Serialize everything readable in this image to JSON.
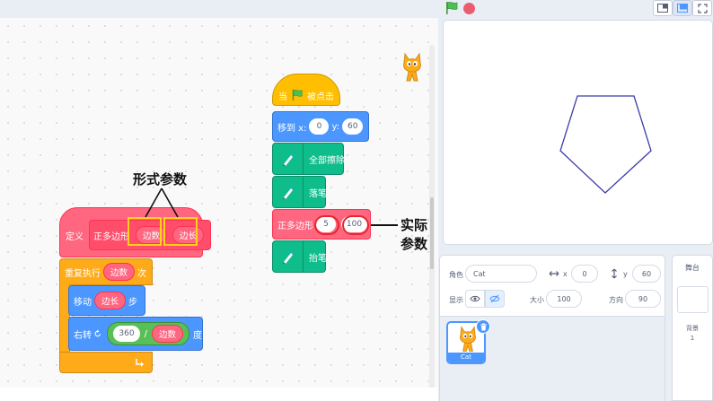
{
  "blocks": {
    "when_flag": {
      "prefix": "当",
      "suffix": "被点击"
    },
    "goto": {
      "label": "移到 x:",
      "x": "0",
      "y_label": "y:",
      "y": "60"
    },
    "clear": "全部擦除",
    "pen_down": "落笔",
    "call": {
      "name": "正多边形",
      "arg1": "5",
      "arg2": "100"
    },
    "pen_up": "抬笔",
    "define": {
      "label": "定义",
      "name": "正多边形",
      "param1": "边数",
      "param2": "边长"
    },
    "repeat": {
      "label": "重复执行",
      "count": "边数",
      "suffix": "次"
    },
    "move": {
      "label": "移动",
      "steps": "边长",
      "suffix": "步"
    },
    "turn": {
      "label": "右转",
      "dividend": "360",
      "op": "/",
      "divisor": "边数",
      "suffix": "度"
    }
  },
  "annotations": {
    "formal": "形式参数",
    "actual": "实际参数"
  },
  "sprite": {
    "name_label": "角色",
    "name": "Cat",
    "x_label": "x",
    "x": "0",
    "y_label": "y",
    "y": "60",
    "show_label": "显示",
    "size_label": "大小",
    "size": "100",
    "direction_label": "方向",
    "direction": "90",
    "thumb_label": "Cat"
  },
  "stage_selector": {
    "title": "舞台",
    "backdrop_label": "背景",
    "backdrop_count": "1"
  },
  "colors": {
    "motion": "#4c97ff",
    "control": "#ffab19",
    "events": "#ffbf00",
    "pen": "#0fbd8c",
    "my_blocks": "#ff6680",
    "operators": "#59c059",
    "highlight_formal": "#ffd21a",
    "highlight_actual": "#e6262b"
  },
  "icons": [
    "green-flag-icon",
    "stop-icon",
    "pen-icon",
    "turn-right-icon",
    "loop-arrow-icon",
    "eye-icon",
    "eye-slash-icon",
    "trash-icon",
    "cat-icon"
  ]
}
